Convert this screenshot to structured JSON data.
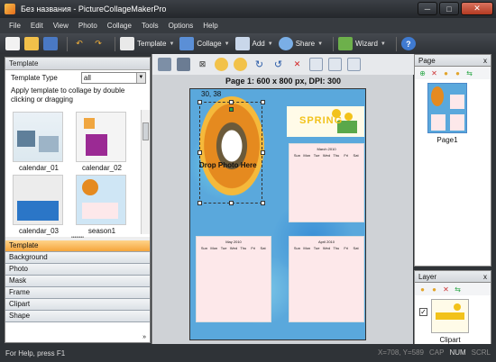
{
  "window": {
    "title": "Без названия - PictureCollageMakerPro",
    "min_label": "─",
    "max_label": "□",
    "close_label": "✕"
  },
  "menu": [
    "File",
    "Edit",
    "View",
    "Photo",
    "Collage",
    "Tools",
    "Options",
    "Help"
  ],
  "toolbar": {
    "template_label": "Template",
    "collage_label": "Collage",
    "add_label": "Add",
    "share_label": "Share",
    "wizard_label": "Wizard"
  },
  "left_panel": {
    "title": "Template",
    "template_type_label": "Template Type",
    "template_type_value": "all",
    "hint": "Apply template to collage by double clicking or dragging",
    "thumbnails": [
      "calendar_01",
      "calendar_02",
      "calendar_03",
      "season1"
    ],
    "tabs": [
      "Template",
      "Background",
      "Photo",
      "Mask",
      "Frame",
      "Clipart",
      "Shape"
    ],
    "more_label": "»"
  },
  "canvas": {
    "page_info": "Page 1: 600 x 800 px, DPI: 300",
    "coords": "30, 38",
    "drop_text": "Drop Photo Here",
    "spring_word": "SPRING",
    "calendars": [
      {
        "title": "March 2010"
      },
      {
        "title": "May 2010"
      },
      {
        "title": "April 2010"
      }
    ],
    "weekdays": [
      "Sun",
      "Mon",
      "Tue",
      "Wed",
      "Thu",
      "Fri",
      "Sat"
    ]
  },
  "page_panel": {
    "title": "Page",
    "close": "x",
    "page_label": "Page1"
  },
  "layer_panel": {
    "title": "Layer",
    "close": "x",
    "layer_label": "Clipart",
    "check": "✓"
  },
  "statusbar": {
    "help": "For Help, press F1",
    "coords": "X=708, Y=589",
    "cap": "CAP",
    "num": "NUM",
    "scrl": "SCRL"
  }
}
